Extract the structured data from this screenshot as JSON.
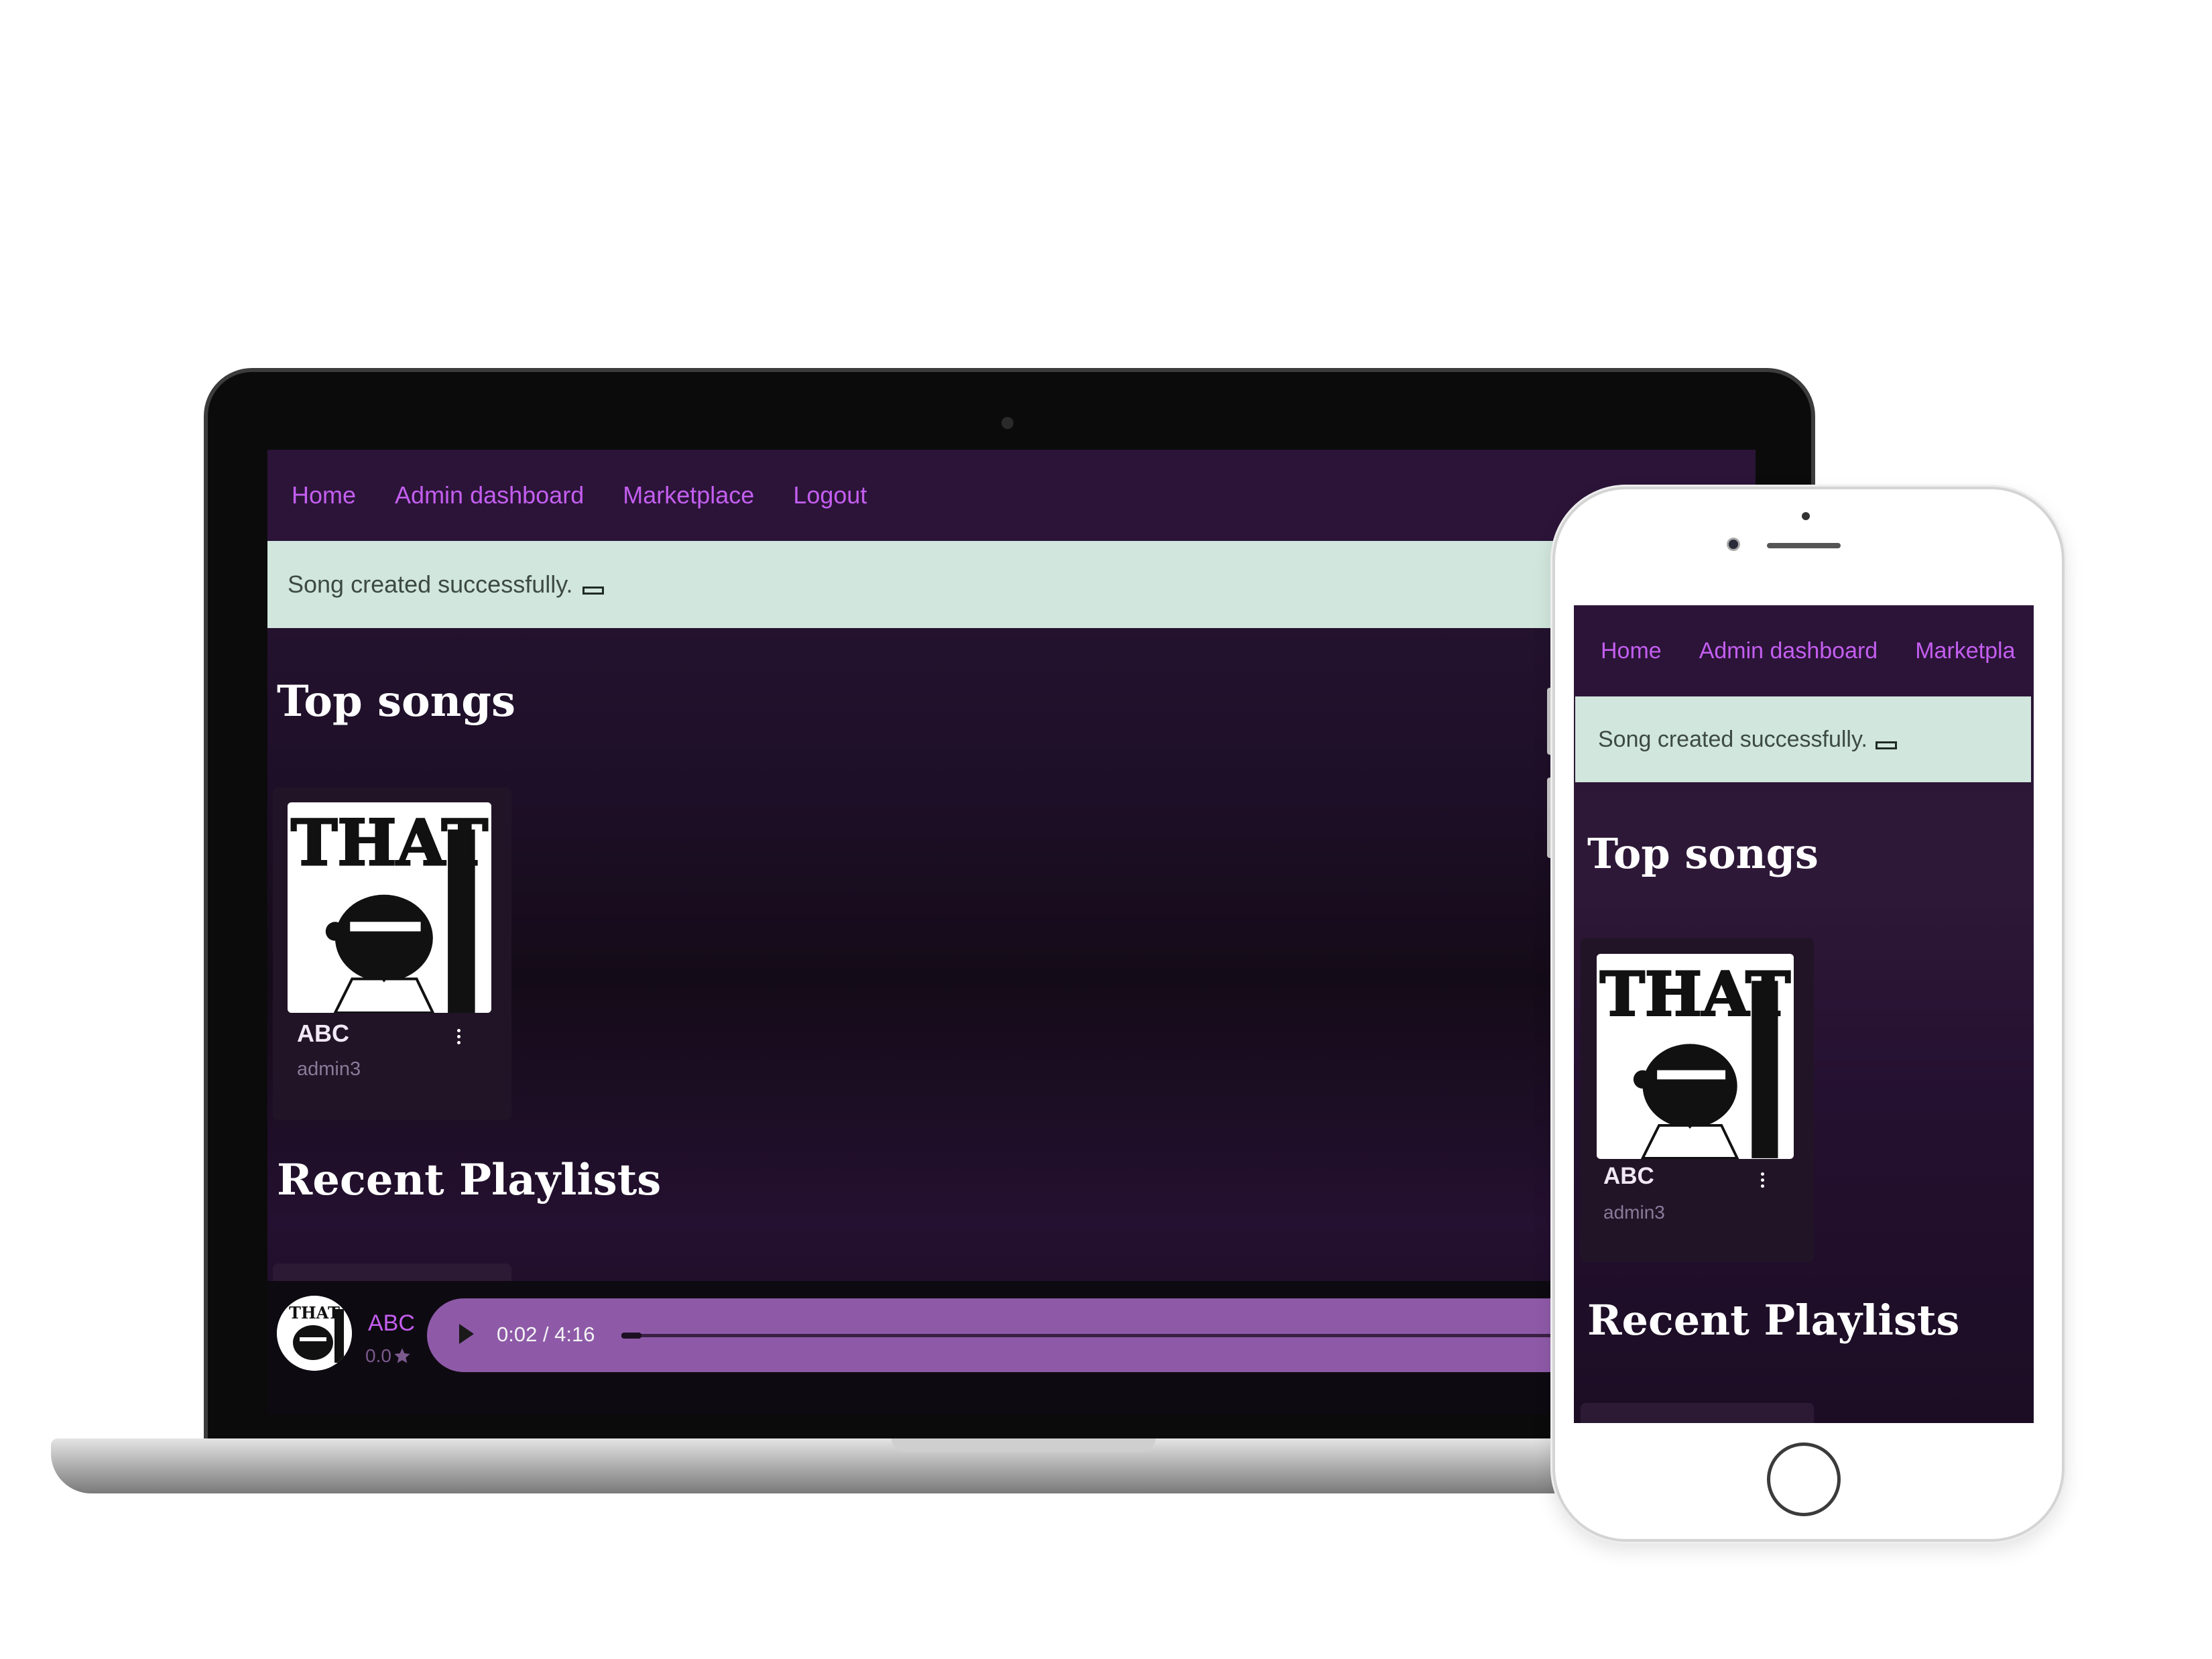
{
  "nav": {
    "home": "Home",
    "admin_dashboard": "Admin dashboard",
    "marketplace": "Marketplace",
    "logout": "Logout"
  },
  "phone_nav": {
    "home": "Home",
    "admin_dashboard": "Admin dashboard",
    "marketplace_truncated": "Marketpla"
  },
  "alert": {
    "message": "Song created successfully."
  },
  "sections": {
    "top_songs": "Top songs",
    "recent_playlists": "Recent Playlists"
  },
  "songs": [
    {
      "title": "ABC",
      "artist": "admin3",
      "cover_text": "THAT"
    }
  ],
  "player": {
    "title": "ABC",
    "rating": "0.0",
    "current_time": "0:02",
    "duration": "4:16",
    "time_display": "0:02 / 4:16",
    "progress_fraction": 0.008
  },
  "colors": {
    "accent": "#c45ef0",
    "nav_bg": "#2b1438",
    "alert_bg": "#d1e6dd",
    "player_bar": "#8e5aa8",
    "page_bg": "#1e0f28"
  },
  "icons": {
    "close": "close-icon",
    "menu": "kebab-menu-icon",
    "play": "play-icon",
    "star": "star-icon"
  }
}
